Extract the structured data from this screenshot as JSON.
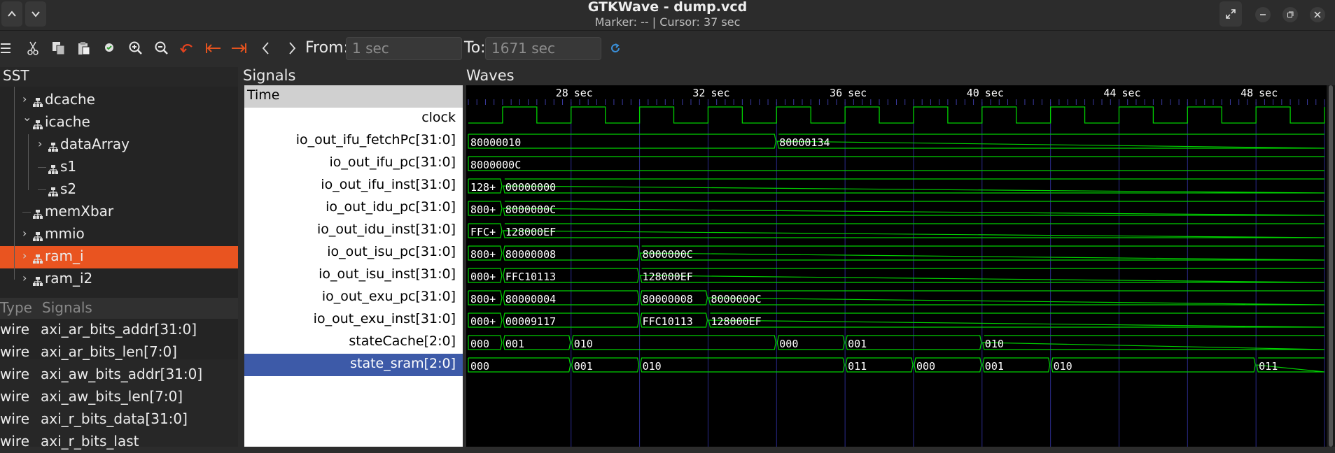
{
  "title": "GTKWave - dump.vcd",
  "subtitle": "Marker: --  |  Cursor: 37 sec",
  "toolbar": {
    "from_label": "From:",
    "from_value": "1 sec",
    "to_label": "To:",
    "to_value": "1671 sec"
  },
  "sst": {
    "title": "SST",
    "tree": [
      {
        "label": "dcache",
        "depth": 1,
        "expand": "collapsed"
      },
      {
        "label": "icache",
        "depth": 1,
        "expand": "expanded"
      },
      {
        "label": "dataArray",
        "depth": 2,
        "expand": "collapsed"
      },
      {
        "label": "s1",
        "depth": 2,
        "expand": "none"
      },
      {
        "label": "s2",
        "depth": 2,
        "expand": "none"
      },
      {
        "label": "memXbar",
        "depth": 1,
        "expand": "none"
      },
      {
        "label": "mmio",
        "depth": 1,
        "expand": "collapsed"
      },
      {
        "label": "ram_i",
        "depth": 1,
        "expand": "collapsed",
        "selected": true
      },
      {
        "label": "ram_i2",
        "depth": 1,
        "expand": "collapsed"
      }
    ],
    "type_header": "Type",
    "signals_header": "Signals",
    "signals": [
      {
        "type": "wire",
        "name": "axi_ar_bits_addr[31:0]"
      },
      {
        "type": "wire",
        "name": "axi_ar_bits_len[7:0]"
      },
      {
        "type": "wire",
        "name": "axi_aw_bits_addr[31:0]"
      },
      {
        "type": "wire",
        "name": "axi_aw_bits_len[7:0]"
      },
      {
        "type": "wire",
        "name": "axi_r_bits_data[31:0]"
      },
      {
        "type": "wire",
        "name": "axi_r_bits_last"
      }
    ]
  },
  "signals_panel": {
    "title": "Signals",
    "time_label": "Time",
    "rows": [
      {
        "name": "clock"
      },
      {
        "name": "io_out_ifu_fetchPc[31:0]"
      },
      {
        "name": "io_out_ifu_pc[31:0]"
      },
      {
        "name": "io_out_ifu_inst[31:0]"
      },
      {
        "name": "io_out_idu_pc[31:0]"
      },
      {
        "name": "io_out_idu_inst[31:0]"
      },
      {
        "name": "io_out_isu_pc[31:0]"
      },
      {
        "name": "io_out_isu_inst[31:0]"
      },
      {
        "name": "io_out_exu_pc[31:0]"
      },
      {
        "name": "io_out_exu_inst[31:0]"
      },
      {
        "name": "stateCache[2:0]"
      },
      {
        "name": "state_sram[2:0]",
        "selected": true
      }
    ]
  },
  "waves": {
    "title": "Waves",
    "unit": "sec",
    "time_start": 25,
    "time_end": 50,
    "time_marks": [
      28,
      32,
      36,
      40,
      44,
      48
    ],
    "clock_period": 2,
    "clock_first_rise": 26,
    "colors": {
      "wave": "#00d000",
      "grid": "#2a2a8a",
      "text": "#ffffff"
    },
    "buses": [
      [
        {
          "t": 25,
          "v": "80000010"
        },
        {
          "t": 34,
          "v": "80000134"
        }
      ],
      [
        {
          "t": 25,
          "v": "8000000C"
        }
      ],
      [
        {
          "t": 25,
          "v": "128+"
        },
        {
          "t": 26,
          "v": "00000000"
        }
      ],
      [
        {
          "t": 25,
          "v": "800+"
        },
        {
          "t": 26,
          "v": "8000000C"
        }
      ],
      [
        {
          "t": 25,
          "v": "FFC+"
        },
        {
          "t": 26,
          "v": "128000EF"
        }
      ],
      [
        {
          "t": 25,
          "v": "800+"
        },
        {
          "t": 26,
          "v": "80000008"
        },
        {
          "t": 30,
          "v": "8000000C"
        }
      ],
      [
        {
          "t": 25,
          "v": "000+"
        },
        {
          "t": 26,
          "v": "FFC10113"
        },
        {
          "t": 30,
          "v": "128000EF"
        }
      ],
      [
        {
          "t": 25,
          "v": "800+"
        },
        {
          "t": 26,
          "v": "80000004"
        },
        {
          "t": 30,
          "v": "80000008"
        },
        {
          "t": 32,
          "v": "8000000C"
        }
      ],
      [
        {
          "t": 25,
          "v": "000+"
        },
        {
          "t": 26,
          "v": "00009117"
        },
        {
          "t": 30,
          "v": "FFC10113"
        },
        {
          "t": 32,
          "v": "128000EF"
        }
      ],
      [
        {
          "t": 25,
          "v": "000"
        },
        {
          "t": 26,
          "v": "001"
        },
        {
          "t": 28,
          "v": "010"
        },
        {
          "t": 34,
          "v": "000"
        },
        {
          "t": 36,
          "v": "001"
        },
        {
          "t": 40,
          "v": "010"
        }
      ],
      [
        {
          "t": 25,
          "v": "000"
        },
        {
          "t": 28,
          "v": "001"
        },
        {
          "t": 30,
          "v": "010"
        },
        {
          "t": 36,
          "v": "011"
        },
        {
          "t": 38,
          "v": "000"
        },
        {
          "t": 40,
          "v": "001"
        },
        {
          "t": 42,
          "v": "010"
        },
        {
          "t": 48,
          "v": "011"
        }
      ]
    ]
  }
}
